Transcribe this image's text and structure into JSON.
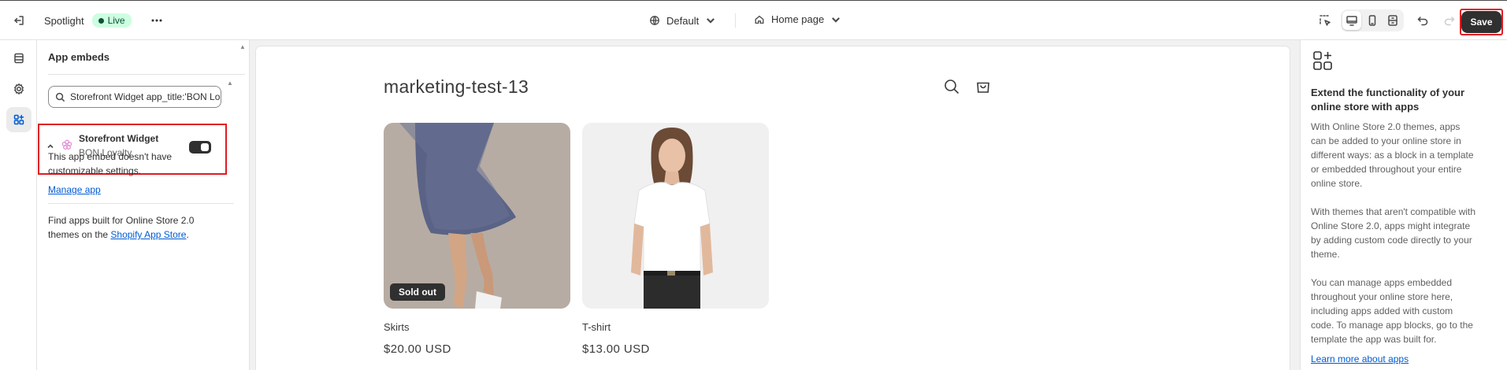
{
  "topbar": {
    "exit_icon": "exit-icon",
    "theme_name": "Spotlight",
    "status_badge": "Live",
    "more_icon": "more-horizontal-icon",
    "theme_selector": "Default",
    "page_selector": "Home page",
    "save_label": "Save"
  },
  "rail": {
    "items": [
      {
        "icon": "sections-icon"
      },
      {
        "icon": "gear-icon"
      },
      {
        "icon": "app-embeds-icon",
        "active": true
      }
    ]
  },
  "panel": {
    "title": "App embeds",
    "search_value": "Storefront Widget app_title:'BON Loyalty'",
    "embed": {
      "name": "Storefront Widget",
      "app": "BON Loyalty",
      "enabled": true
    },
    "no_settings_text": "This app embed doesn't have customizable settings.",
    "manage_link": "Manage app",
    "find_apps_text": "Find apps built for Online Store 2.0 themes on the ",
    "app_store_link": "Shopify App Store",
    "find_apps_end": "."
  },
  "preview": {
    "store_name": "marketing-test-13",
    "products": [
      {
        "title": "Skirts",
        "price": "$20.00 USD",
        "badge": "Sold out"
      },
      {
        "title": "T-shirt",
        "price": "$13.00 USD"
      }
    ]
  },
  "info_panel": {
    "heading": "Extend the functionality of your online store with apps",
    "p1": "With Online Store 2.0 themes, apps can be added to your online store in different ways: as a block in a template or embedded throughout your entire online store.",
    "p2": "With themes that aren't compatible with Online Store 2.0, apps might integrate by adding custom code directly to your theme.",
    "p3": "You can manage apps embedded throughout your online store here, including apps added with custom code. To manage app blocks, go to the template the app was built for.",
    "learn_link": "Learn more about apps"
  },
  "colors": {
    "accent": "#005bd3",
    "highlight": "#e01b24",
    "live_bg": "#cdfee1"
  }
}
